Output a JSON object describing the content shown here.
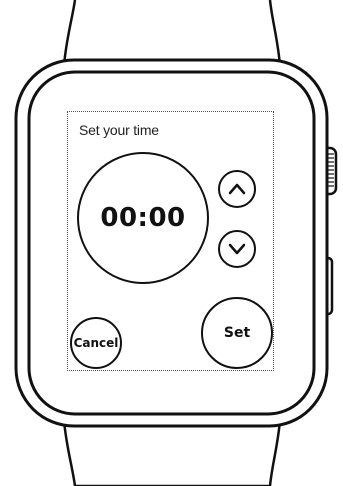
{
  "screen": {
    "title": "Set your time",
    "time": "00:00"
  },
  "controls": {
    "increase_icon": "chevron-up-icon",
    "decrease_icon": "chevron-down-icon",
    "cancel_label": "Cancel",
    "set_label": "Set"
  },
  "colors": {
    "stroke": "#111111",
    "background": "#ffffff"
  }
}
